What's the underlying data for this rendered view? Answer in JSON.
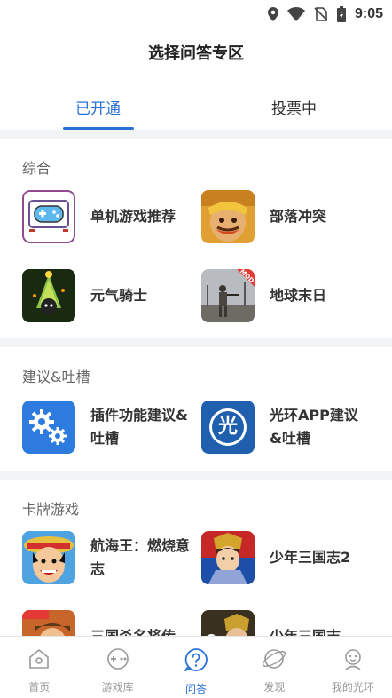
{
  "status_bar": {
    "time": "9:05",
    "icons": [
      "location-icon",
      "wifi-icon",
      "no-sim-icon",
      "battery-icon"
    ]
  },
  "header": {
    "title": "选择问答专区"
  },
  "tabs": [
    {
      "label": "已开通",
      "active": true
    },
    {
      "label": "投票中",
      "active": false
    }
  ],
  "sections": [
    {
      "title": "综合",
      "items": [
        {
          "label": "单机游戏推荐",
          "icon": "gamepad-icon"
        },
        {
          "label": "部落冲突",
          "icon": "clash-of-clans-icon"
        },
        {
          "label": "元气骑士",
          "icon": "soul-knight-icon"
        },
        {
          "label": "地球末日",
          "icon": "last-day-on-earth-icon",
          "badge": "MOD"
        }
      ]
    },
    {
      "title": "建议&吐槽",
      "items": [
        {
          "label": "插件功能建议&吐槽",
          "icon": "gears-icon"
        },
        {
          "label": "光环APP建议&吐槽",
          "icon": "guanghuan-logo-icon",
          "logo_text": "光"
        }
      ]
    },
    {
      "title": "卡牌游戏",
      "items": [
        {
          "label": "航海王：燃烧意志",
          "icon": "one-piece-icon"
        },
        {
          "label": "少年三国志2",
          "icon": "three-kingdoms-2-icon"
        },
        {
          "label": "三国杀名将传",
          "icon": "sanguosha-icon"
        },
        {
          "label": "少年三国志",
          "icon": "three-kingdoms-icon"
        }
      ]
    }
  ],
  "bottom_nav": [
    {
      "label": "首页",
      "icon": "home-icon",
      "active": false
    },
    {
      "label": "游戏库",
      "icon": "game-library-icon",
      "active": false
    },
    {
      "label": "问答",
      "icon": "question-icon",
      "active": true
    },
    {
      "label": "发现",
      "icon": "discover-icon",
      "active": false
    },
    {
      "label": "我的光环",
      "icon": "profile-icon",
      "active": false
    }
  ],
  "colors": {
    "accent": "#2a72d8",
    "divider": "#f2f3f5",
    "text_muted": "#999999"
  }
}
